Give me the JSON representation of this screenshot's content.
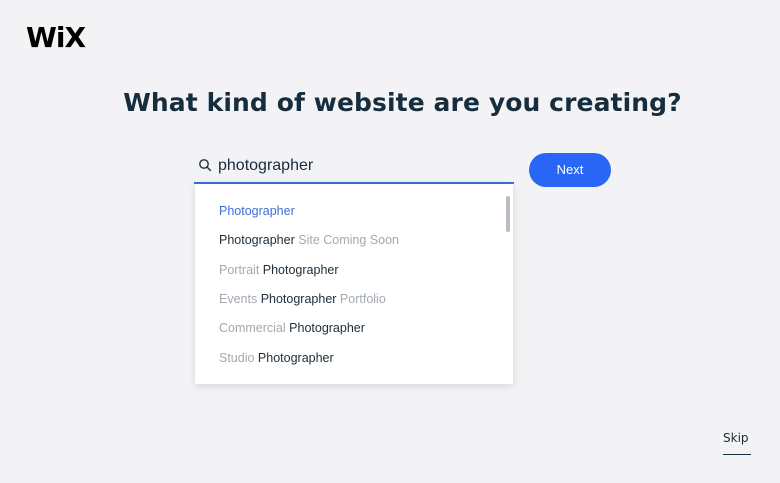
{
  "brand": {
    "logo_text": "WiX"
  },
  "headline": "What kind of website are you creating?",
  "search": {
    "value": "photographer",
    "icon": "search-icon",
    "accent_color": "#3b6fdc"
  },
  "next_button": {
    "label": "Next",
    "color": "#2a66f5"
  },
  "suggestions": [
    {
      "parts": [
        {
          "text": "Photographer",
          "style": "strong"
        }
      ],
      "selected": true
    },
    {
      "parts": [
        {
          "text": "Photographer",
          "style": "strong"
        },
        {
          "text": " Site Coming Soon",
          "style": "muted"
        }
      ],
      "selected": false
    },
    {
      "parts": [
        {
          "text": "Portrait ",
          "style": "muted"
        },
        {
          "text": "Photographer",
          "style": "strong"
        }
      ],
      "selected": false
    },
    {
      "parts": [
        {
          "text": "Events ",
          "style": "muted"
        },
        {
          "text": "Photographer",
          "style": "strong"
        },
        {
          "text": " Portfolio",
          "style": "muted"
        }
      ],
      "selected": false
    },
    {
      "parts": [
        {
          "text": "Commercial ",
          "style": "muted"
        },
        {
          "text": "Photographer",
          "style": "strong"
        }
      ],
      "selected": false
    },
    {
      "parts": [
        {
          "text": "Studio ",
          "style": "muted"
        },
        {
          "text": "Photographer",
          "style": "strong"
        }
      ],
      "selected": false
    }
  ],
  "skip": {
    "label": "Skip"
  }
}
